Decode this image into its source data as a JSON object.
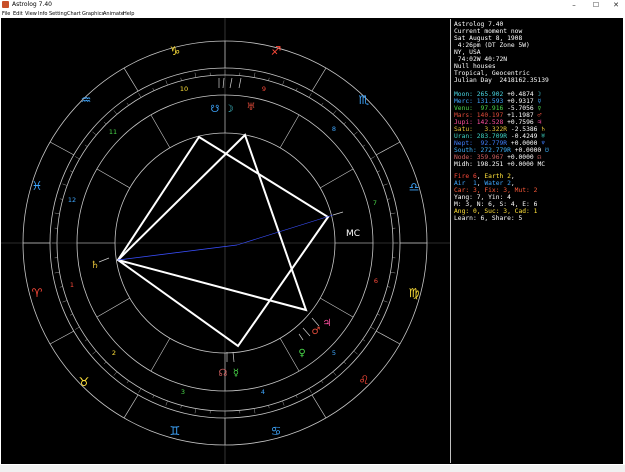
{
  "window": {
    "title": "Astrolog 7.40",
    "controls": [
      "–",
      "☐",
      "✕"
    ]
  },
  "menu": [
    "File",
    "Edit",
    "View",
    "Info",
    "Setting",
    "Chart",
    "Graphics",
    "Animate",
    "Help"
  ],
  "header": [
    "Astrolog 7.40",
    "Current moment now",
    "Sat August 8, 1908",
    " 4:26pm (DT Zone 5W)",
    "NY, USA",
    " 74:02W 40:72N",
    "Null houses",
    "Tropical, Geocentric",
    "Julian Day  2418162.35139"
  ],
  "planets": [
    {
      "name": "Moon:",
      "pos": "265.902",
      "rate": "+0.4874",
      "glyph": "☽",
      "color": "#4ad9e6"
    },
    {
      "name": "Merc:",
      "pos": "131.593",
      "rate": "+0.9317",
      "glyph": "☿",
      "color": "#3fa7ff"
    },
    {
      "name": "Venu:",
      "pos": " 97.916",
      "rate": "-5.7056",
      "glyph": "♀",
      "color": "#4ad94a"
    },
    {
      "name": "Mars:",
      "pos": "140.197",
      "rate": "+1.1987",
      "glyph": "♂",
      "color": "#e04b3a"
    },
    {
      "name": "Jupi:",
      "pos": "142.528",
      "rate": "+0.7596",
      "glyph": "♃",
      "color": "#ff4fa2"
    },
    {
      "name": "Satu:",
      "pos": "  3.322R",
      "rate": "-2.5386",
      "glyph": "♄",
      "color": "#e8c43a"
    },
    {
      "name": "Uran:",
      "pos": "283.709R",
      "rate": "-0.4249",
      "glyph": "♅",
      "color": "#3fd6c6"
    },
    {
      "name": "Nept:",
      "pos": " 92.779R",
      "rate": "+0.0000",
      "glyph": "♆",
      "color": "#3f7fff"
    },
    {
      "name": "South:",
      "pos": "272.779R",
      "rate": "+0.0000",
      "glyph": "☋",
      "color": "#3fb4ff"
    },
    {
      "name": "Node:",
      "pos": "359.967",
      "rate": "+0.0000",
      "glyph": "☊",
      "color": "#d06060"
    },
    {
      "name": "Midh:",
      "pos": "198.251",
      "rate": "+0.0000",
      "glyph": "MC",
      "color": "#ffffff"
    }
  ],
  "elements": [
    {
      "label": "Fire",
      "value": "6",
      "color": "#ff4a3a",
      "label2": "Earth",
      "value2": "2",
      "color2": "#ffe13a"
    },
    {
      "label": "Air",
      "value": "1",
      "color": "#3fa7ff",
      "label2": "Water",
      "value2": "2",
      "color2": "#3fa7ff"
    }
  ],
  "modes": "Car: 3, Fix: 3, Mut: 2",
  "yang_yin": "Yang: 7, Yin: 4",
  "hemispheres": "M: 3, N: 6, S: 4, E: 6",
  "aspect_quads": "Ang: 0, Suc: 3, Cad: 1",
  "learn_share": "Learn: 6, Share: 5",
  "chart": {
    "houses": [
      "1",
      "2",
      "3",
      "4",
      "5",
      "6",
      "7",
      "8",
      "9",
      "10",
      "11",
      "12"
    ],
    "signs": [
      "♈",
      "♉",
      "♊",
      "♋",
      "♌",
      "♍",
      "♎",
      "♏",
      "♐",
      "♑",
      "♒",
      "♓"
    ],
    "planet_glyphs": [
      "☽",
      "☿",
      "♀",
      "♂",
      "♃",
      "♄",
      "♅",
      "♆",
      "☋",
      "☊",
      "MC"
    ]
  }
}
